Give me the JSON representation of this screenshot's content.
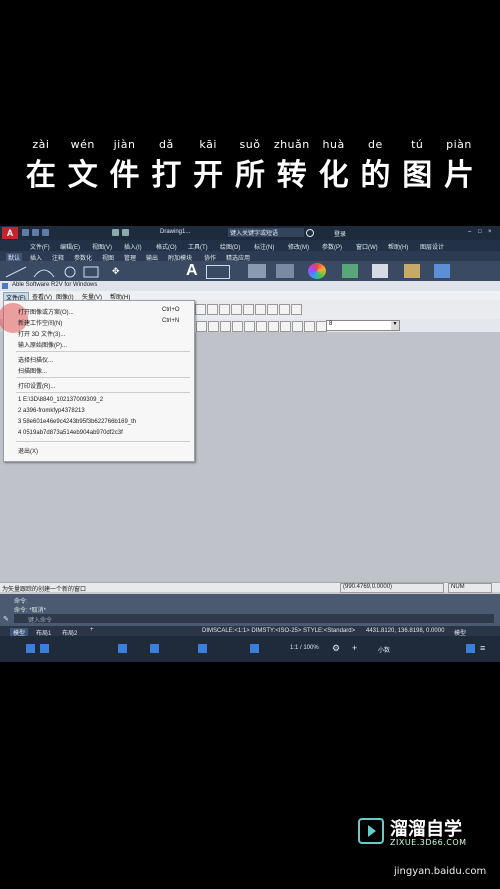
{
  "caption": {
    "pinyin": [
      "zài",
      "wén",
      "jiàn",
      "dǎ",
      "kāi",
      "suǒ",
      "zhuǎn",
      "huà",
      "de",
      "tú",
      "piàn"
    ],
    "hanzi": [
      "在",
      "文",
      "件",
      "打",
      "开",
      "所",
      "转",
      "化",
      "的",
      "图",
      "片"
    ]
  },
  "acad": {
    "doc_tab": "Drawing1...",
    "search": "键入关键字或短语",
    "login": "登录",
    "menu": [
      "文件(F)",
      "编辑(E)",
      "视图(V)",
      "插入(I)",
      "格式(O)",
      "工具(T)",
      "绘图(D)",
      "标注(N)",
      "修改(M)",
      "参数(P)",
      "窗口(W)",
      "帮助(H)",
      "图层设计"
    ],
    "ribbon_tabs": [
      "默认",
      "插入",
      "注释",
      "参数化",
      "视图",
      "管理",
      "输出",
      "附加模块",
      "协作",
      "精选应用"
    ]
  },
  "r2v": {
    "title": "Able Software R2V for Windows",
    "menu": [
      "文件(F)",
      "查看(V)",
      "图像(I)",
      "矢量(V)",
      "帮助(H)"
    ],
    "dropdown": {
      "items": [
        {
          "label": "打开图像或方案(O)...",
          "shortcut": "Ctrl+O"
        },
        {
          "label": "新建工作空间(N)",
          "shortcut": "Ctrl+N"
        },
        {
          "label": "打开 3D 文件(3)...",
          "shortcut": ""
        },
        {
          "label": "输入原始图像(P)...",
          "shortcut": ""
        },
        {
          "label": "选择扫描仪...",
          "shortcut": ""
        },
        {
          "label": "扫描图像...",
          "shortcut": ""
        },
        {
          "label": "打印设置(R)...",
          "shortcut": ""
        },
        {
          "label": "1 E:\\3D\\8840_102137009309_2",
          "shortcut": ""
        },
        {
          "label": "2 a396-fromkfyp4378213",
          "shortcut": ""
        },
        {
          "label": "3 58e601e46e9c4243b95f3b622766b169_th",
          "shortcut": ""
        },
        {
          "label": "4 0519ab7d873a514eb904ab970df2c3f",
          "shortcut": ""
        },
        {
          "label": "退出(X)",
          "shortcut": ""
        }
      ]
    },
    "toolbar_combo": "8",
    "status_left": "为矢量跟踪的创建一个新的窗口",
    "status_coords": "(990.4769,0.0000)",
    "status_num": "NUM"
  },
  "command": {
    "line1": "命令:",
    "line2": "命令: *取消*",
    "input_placeholder": "键入命令"
  },
  "layout_tabs": [
    "模型",
    "布局1",
    "布局2"
  ],
  "bottom": {
    "dims": "DIMSCALE:<1:1> DIMSTY:<ISO-25> STYLE:<Standard>",
    "coords": "4431.8120, 136.8198, 0.0000",
    "model": "模型",
    "scale": "1:1 / 100%",
    "units": "小数"
  },
  "watermark": {
    "title": "溜溜自学",
    "sub": "ZIXUE.3D66.COM",
    "url": "jingyan.baidu.com"
  },
  "colors": {
    "dark_ui": "#1e2b3d",
    "accent_red": "#d9534f",
    "highlight": "#e05555"
  }
}
